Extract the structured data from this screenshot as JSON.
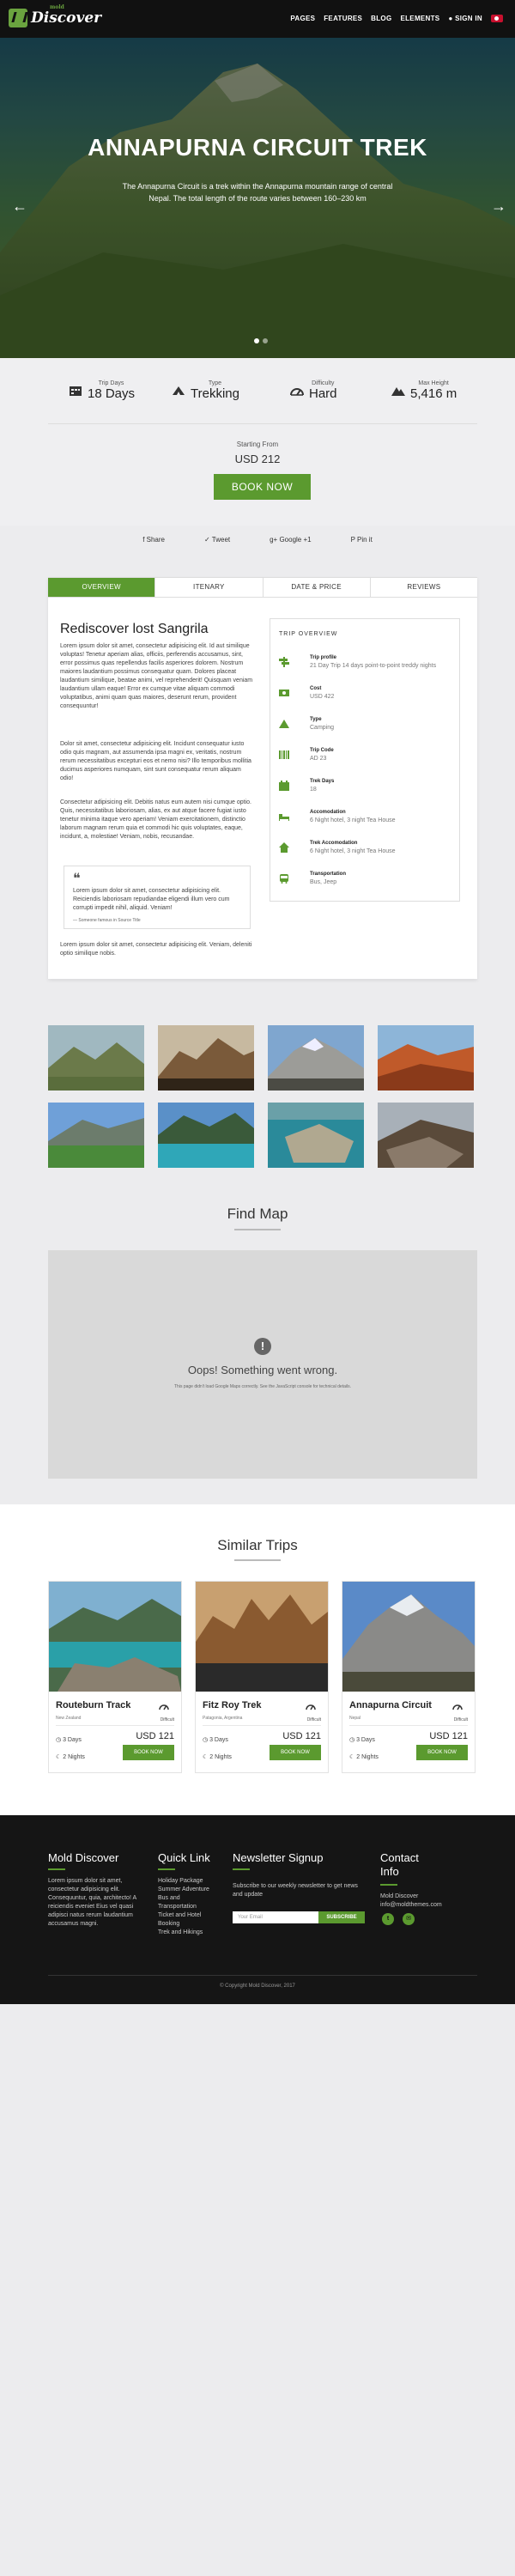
{
  "header": {
    "logo_small": "mold",
    "logo_word": "Discover",
    "nav": [
      "PAGES",
      "FEATURES",
      "BLOG",
      "ELEMENTS"
    ],
    "signin": "SIGN IN"
  },
  "hero": {
    "title": "ANNAPURNA CIRCUIT TREK",
    "subtitle": "The Annapurna Circuit is a trek within the Annapurna mountain range of central Nepal. The total length of the route varies between 160–230 km",
    "prev_arrow": "←",
    "next_arrow": "→"
  },
  "facts": [
    {
      "label": "Trip Days",
      "value": "18 Days",
      "icon": "calendar-icon"
    },
    {
      "label": "Type",
      "value": "Trekking",
      "icon": "tent-icon"
    },
    {
      "label": "Difficulty",
      "value": "Hard",
      "icon": "gauge-icon"
    },
    {
      "label": "Max Height",
      "value": "5,416 m",
      "icon": "mountain-icon"
    }
  ],
  "booking": {
    "starting_from": "Starting From",
    "price": "USD 212",
    "book_now": "BOOK NOW"
  },
  "share": [
    "f Share",
    "✓ Tweet",
    "g+ Google +1",
    "P Pin it"
  ],
  "tabs": [
    "OVERVIEW",
    "ITENARY",
    "DATE & PRICE",
    "REVIEWS"
  ],
  "content": {
    "heading": "Rediscover lost Sangrila",
    "p1": "Lorem ipsum dolor sit amet, consectetur adipisicing elit. Id aut similique voluptas! Tenetur aperiam alias, officiis, perferendis accusamus, sint, error possimus quas repellendus facilis asperiores dolorem. Nostrum maiores laudantium possimus consequatur quam. Dolores placeat laudantium similique, beatae animi, vel reprehenderit! Quisquam veniam laudantium ullam eaque! Error ex cumque vitae aliquam commodi voluptatibus, animi quam quas maiores, deserunt rerum, provident consequuntur!",
    "p2": "Dolor sit amet, consectetur adipisicing elit. Incidunt consequatur iusto odio quis magnam, aut assumenda ipsa magni ex, veritatis, nostrum rerum necessitatibus excepturi eos et nemo nisi? Illo temporibus mollitia ducimus asperiores numquam, sint sunt consequatur rerum aliquam odio!",
    "p3": "Consectetur adipisicing elit. Debitis natus eum autem nisi cumque optio. Quis, necessitatibus laboriosam, alias, ex aut atque facere fugiat iusto tenetur minima itaque vero aperiam! Veniam exercitationem, distinctio laborum magnam rerum quia et commodi hic quis voluptates, eaque, incidunt, a, molestiae! Veniam, nobis, recusandae.",
    "quote_mark": "❝",
    "quote": "Lorem ipsum dolor sit amet, consectetur adipisicing elit. Reiciendis laboriosam repudiandae eligendi illum vero cum corrupti impedit nihil, aliquid. Veniam!",
    "quote_author": "— Someone famous in Source Title",
    "p4": "Lorem ipsum dolor sit amet, consectetur adipisicing elit. Veniam, deleniti optio similique nobis."
  },
  "overview": {
    "heading": "TRIP OVERVIEW",
    "items": [
      {
        "key": "Trip profile",
        "value": "21 Day Trip 14 days point-to-point treddy nights"
      },
      {
        "key": "Cost",
        "value": "USD 422"
      },
      {
        "key": "Type",
        "value": "Camping"
      },
      {
        "key": "Trip Code",
        "value": "AD 23"
      },
      {
        "key": "Trek Days",
        "value": "18"
      },
      {
        "key": "Accomodation",
        "value": "6 Night hotel, 3 night Tea House"
      },
      {
        "key": "Trek Accomodation",
        "value": "6 Night hotel, 3 night Tea House"
      },
      {
        "key": "Transportation",
        "value": "Bus, Jeep"
      }
    ]
  },
  "map": {
    "title": "Find Map",
    "error_icon": "!",
    "error_title": "Oops! Something went wrong.",
    "error_sub": "This page didn't load Google Maps correctly. See the JavaScript console for technical details."
  },
  "similar": {
    "title": "Similar Trips",
    "cards": [
      {
        "name": "Routeburn Track",
        "location": "New Zealand",
        "difficulty": "Difficult",
        "price": "USD 121",
        "days": "3 Days",
        "nights": "2 Nights",
        "book": "BOOK NOW"
      },
      {
        "name": "Fitz Roy Trek",
        "location": "Patagonia, Argentina",
        "difficulty": "Difficult",
        "price": "USD 121",
        "days": "3 Days",
        "nights": "2 Nights",
        "book": "BOOK NOW"
      },
      {
        "name": "Annapurna Circuit",
        "location": "Nepal",
        "difficulty": "Difficult",
        "price": "USD 121",
        "days": "3 Days",
        "nights": "2 Nights",
        "book": "BOOK NOW"
      }
    ]
  },
  "footer": {
    "col1_title": "Mold Discover",
    "col1_text": "Lorem ipsum dolor sit amet, consectetur adipisicing elit. Consequuntur, quia, architecto! A reiciendis eveniet Eius vel quasi adipisci natus rerum laudantium accusamus magni.",
    "col2_title": "Quick Link",
    "links": [
      "Holiday Package",
      "Summer Adventure",
      "Bus and Transportation",
      "Ticket and Hotel Booking",
      "Trek and Hikings"
    ],
    "col3_title": "Newsletter Signup",
    "col3_text": "Subscribe to our weekly newsletter to get news and update",
    "email_placeholder": "Your Email",
    "subscribe": "SUBSCRIBE",
    "col4_title": "Contact Info",
    "company": "Mold Discover",
    "email": "info@moldthemes.com",
    "copyright": "© Copyright Mold Discover, 2017"
  }
}
